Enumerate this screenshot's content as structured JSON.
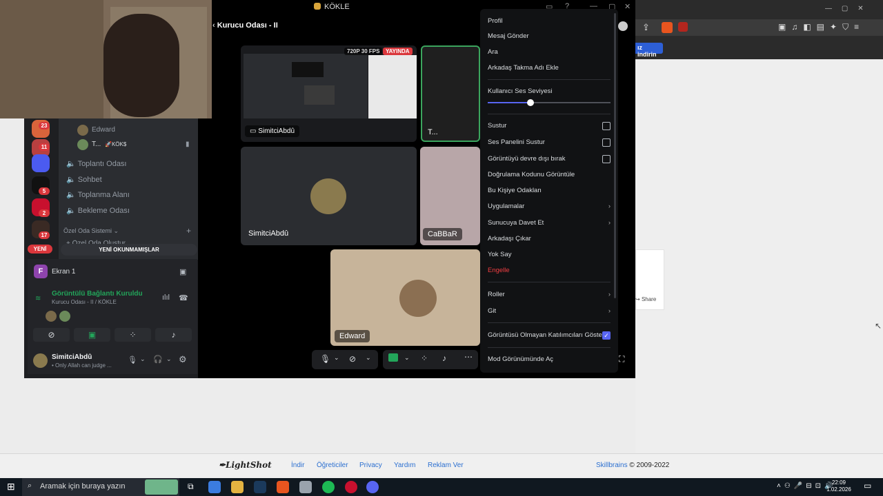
{
  "discord": {
    "window_title": "KÖKLE",
    "channel_header": "Kurucu Odası - II",
    "stream_badge_quality": "720P 30 FPS",
    "stream_badge_live": "YAYINDA",
    "tiles": [
      {
        "name": "SimitciAbdû"
      },
      {
        "name": "T..."
      },
      {
        "name": "SimitciAbdû"
      },
      {
        "name": "CaBBaR"
      },
      {
        "name": "Edward"
      }
    ],
    "voice_members": [
      {
        "name": "Edward"
      },
      {
        "name": "T...",
        "tag": "KÖK$"
      }
    ],
    "channels": [
      "Toplantı Odası",
      "Sohbet",
      "Toplanma Alanı",
      "Bekleme Odası"
    ],
    "category": "Özel Oda Sistemi",
    "category_child": "Özel Oda Oluştur",
    "server_badges": [
      "23",
      "11",
      "5",
      "2",
      "17"
    ],
    "new_pill": "YENİ",
    "unread_bar": "YENİ OKUNMAMIŞLAR",
    "screen_share_label": "Ekran 1",
    "screen_share_letter": "F",
    "connection_status": "Görüntülü Bağlantı Kuruldu",
    "connection_location": "Kurucu Odası - II / KÖKLE",
    "user": {
      "name": "SimitciAbdû",
      "status": "• Only Allah can judge ..."
    }
  },
  "context_menu": {
    "items": [
      "Profil",
      "Mesaj Gönder",
      "Ara",
      "Arkadaş Takma Adı Ekle",
      "Kullanıcı Ses Seviyesi",
      "Sustur",
      "Ses Panelini Sustur",
      "Görüntüyü devre dışı bırak",
      "Doğrulama Kodunu Görüntüle",
      "Bu Kişiye Odaklan",
      "Uygulamalar",
      "Sunucuya Davet Et",
      "Arkadaşı Çıkar",
      "Yok Say",
      "Engelle",
      "Roller",
      "Git",
      "Görüntüsü Olmayan Katılımcıları Göster",
      "Mod Görünümünde Aç"
    ],
    "volume_level": 0.35,
    "colors": {
      "danger": "#f23f43",
      "accent": "#5865f2"
    }
  },
  "browser": {
    "install_button": "ız indirin",
    "share_label": "Share"
  },
  "lightshot_footer": {
    "logo": "LightShot",
    "links": [
      "İndir",
      "Öğreticiler",
      "Privacy",
      "Yardım",
      "Reklam Ver"
    ],
    "brand": "Skillbrains",
    "copyright": "© 2009-2022"
  },
  "taskbar": {
    "search_placeholder": "Aramak için buraya yazın",
    "time": "22:09",
    "date": "1.02.2026"
  }
}
